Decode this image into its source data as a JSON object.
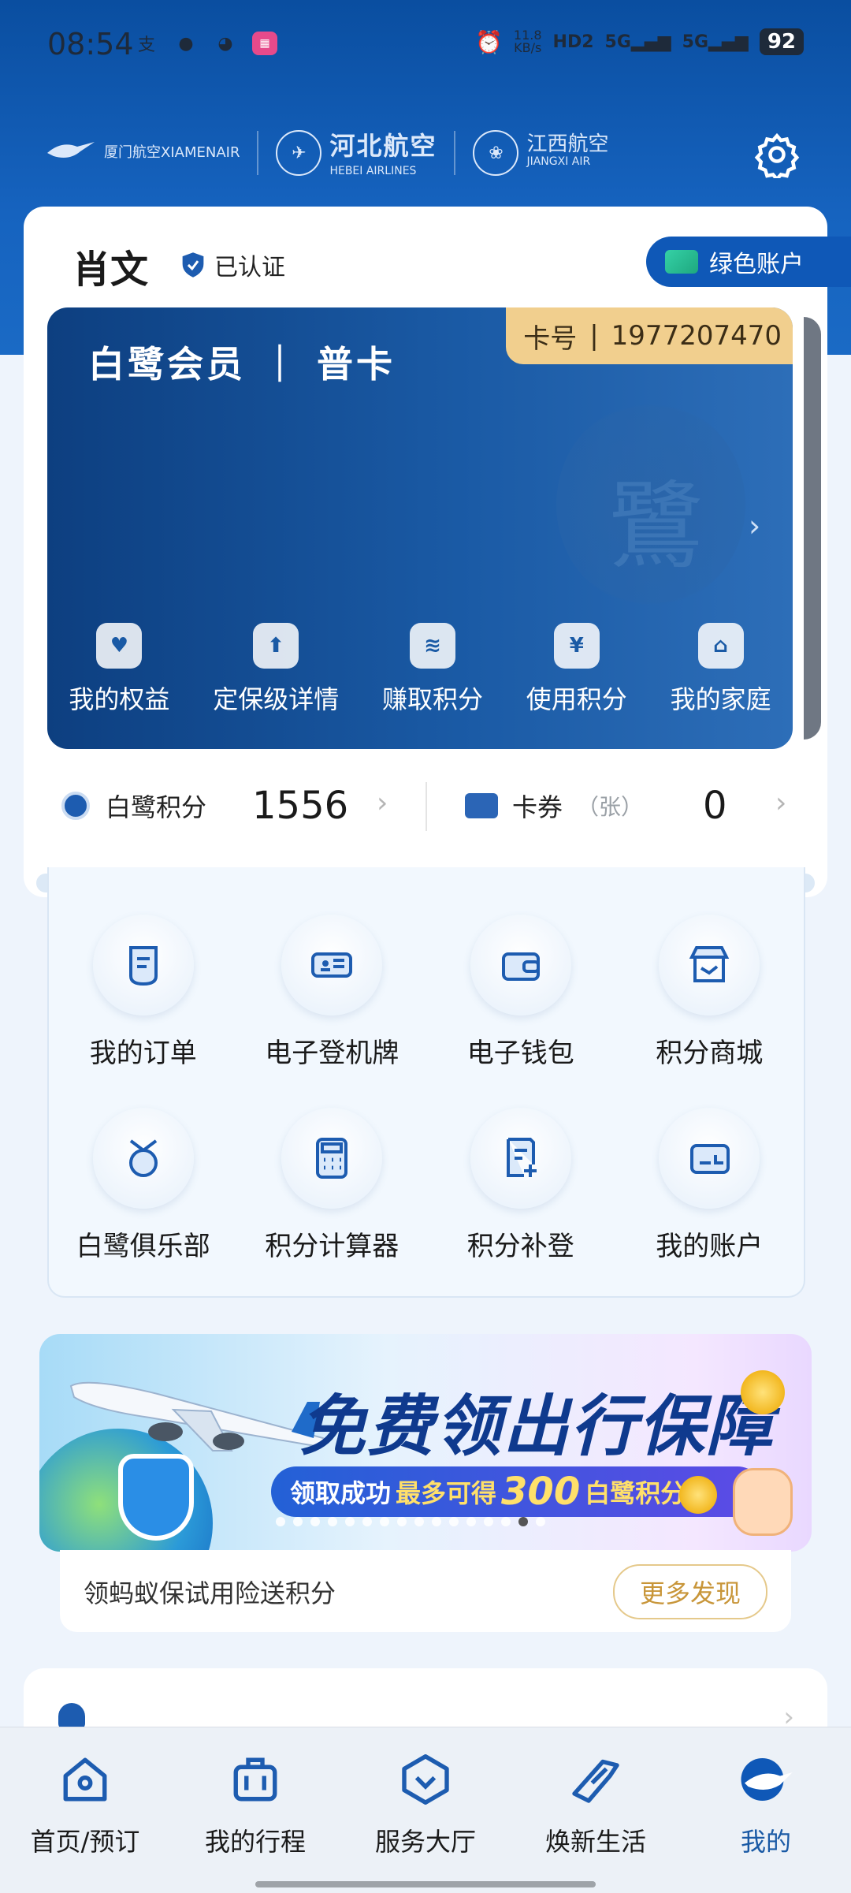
{
  "status": {
    "time": "08:54",
    "left_icons": [
      "alipay-icon",
      "message-icon",
      "wechat-icon",
      "app-icon"
    ],
    "net_speed_value": "11.8",
    "net_speed_unit": "KB/s",
    "hd": "HD2",
    "sim1": "5G",
    "sim2": "5G",
    "battery": "92"
  },
  "header": {
    "airlines": [
      {
        "name": "厦门航空",
        "latin": "XIAMENAIR"
      },
      {
        "name": "河北航空",
        "latin": "HEBEI AIRLINES"
      },
      {
        "name": "江西航空",
        "latin": "JIANGXI AIR"
      }
    ],
    "settings_icon": "gear-icon"
  },
  "profile": {
    "name": "肖文",
    "verified_label": "已认证",
    "green_account_label": "绿色账户"
  },
  "card": {
    "title": "白鹭会员 ｜ 普卡",
    "card_no_label": "卡号",
    "card_no_sep": "|",
    "card_no": "1977207470",
    "actions": [
      {
        "label": "我的权益",
        "icon": "heart-icon"
      },
      {
        "label": "定保级详情",
        "icon": "upgrade-icon"
      },
      {
        "label": "赚取积分",
        "icon": "coins-icon"
      },
      {
        "label": "使用积分",
        "icon": "yen-coin-icon"
      },
      {
        "label": "我的家庭",
        "icon": "home-icon"
      }
    ]
  },
  "summary": {
    "points_label": "白鹭积分",
    "points_value": "1556",
    "coupons_label": "卡券",
    "coupons_unit": "（张）",
    "coupons_value": "0"
  },
  "services": [
    {
      "label": "我的订单",
      "icon": "order-icon"
    },
    {
      "label": "电子登机牌",
      "icon": "boarding-pass-icon"
    },
    {
      "label": "电子钱包",
      "icon": "wallet-icon"
    },
    {
      "label": "积分商城",
      "icon": "store-icon"
    },
    {
      "label": "白鹭俱乐部",
      "icon": "medal-icon"
    },
    {
      "label": "积分计算器",
      "icon": "calculator-icon"
    },
    {
      "label": "积分补登",
      "icon": "document-add-icon"
    },
    {
      "label": "我的账户",
      "icon": "account-card-icon"
    }
  ],
  "banner": {
    "title": "免费领出行保障",
    "pill_prefix": "领取成功",
    "pill_highlight": "最多可得",
    "pill_number": "300",
    "pill_suffix": "白鹭积分！",
    "dot_count": 16,
    "active_dot": 14
  },
  "insurance": {
    "text": "领蚂蚁保试用险送积分",
    "button": "更多发现"
  },
  "tabbar": {
    "tabs": [
      {
        "label": "首页/预订",
        "icon": "home-tab-icon"
      },
      {
        "label": "我的行程",
        "icon": "luggage-icon"
      },
      {
        "label": "服务大厅",
        "icon": "service-icon"
      },
      {
        "label": "焕新生活",
        "icon": "plane-ticket-icon"
      },
      {
        "label": "我的",
        "icon": "egret-icon"
      }
    ],
    "active_index": 4,
    "active_color": "#1a5aa5"
  }
}
